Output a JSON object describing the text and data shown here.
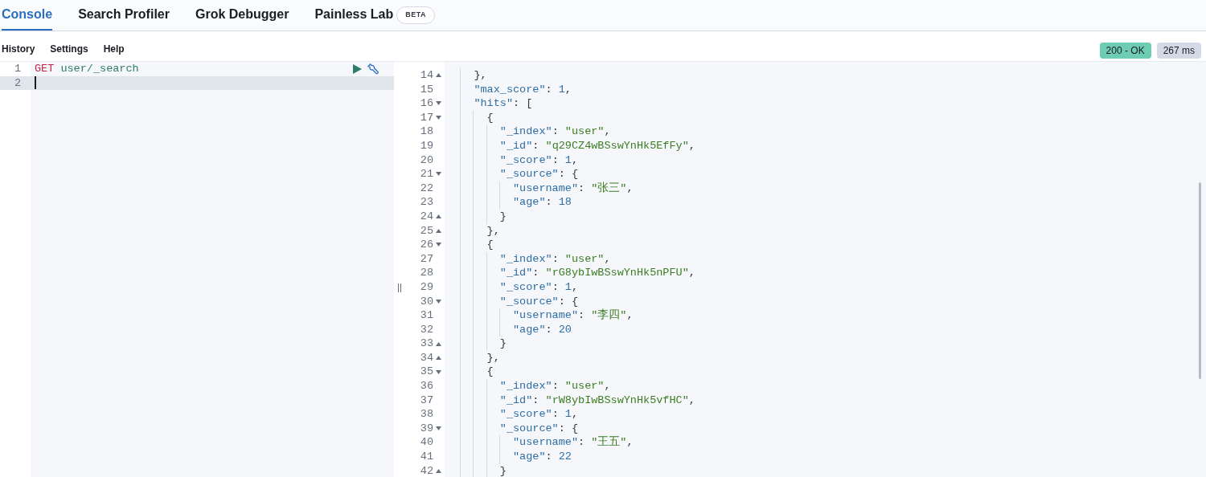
{
  "tabs": [
    {
      "label": "Console",
      "selected": true
    },
    {
      "label": "Search Profiler",
      "selected": false
    },
    {
      "label": "Grok Debugger",
      "selected": false
    },
    {
      "label": "Painless Lab",
      "selected": false,
      "badge": "BETA"
    }
  ],
  "menu": [
    "History",
    "Settings",
    "Help"
  ],
  "status": {
    "code": "200 - OK",
    "time": "267 ms"
  },
  "request": {
    "lines": [
      {
        "number": "1",
        "active": false,
        "tokens": [
          {
            "kind": "method",
            "text": "GET"
          },
          {
            "kind": "path",
            "text": " user/_search"
          }
        ]
      },
      {
        "number": "2",
        "active": true
      }
    ]
  },
  "response": {
    "lines": [
      {
        "number": "14",
        "kind": "close",
        "tokens": [
          {
            "kind": "punct",
            "text": "    },"
          }
        ]
      },
      {
        "number": "15",
        "kind": "plain",
        "tokens": [
          {
            "kind": "key",
            "text": "    \"max_score\""
          },
          {
            "kind": "punct",
            "text": ": "
          },
          {
            "kind": "number",
            "text": "1"
          },
          {
            "kind": "punct",
            "text": ","
          }
        ]
      },
      {
        "number": "16",
        "kind": "open",
        "tokens": [
          {
            "kind": "key",
            "text": "    \"hits\""
          },
          {
            "kind": "punct",
            "text": ": ["
          }
        ]
      },
      {
        "number": "17",
        "kind": "open",
        "tokens": [
          {
            "kind": "punct",
            "text": "      {"
          }
        ]
      },
      {
        "number": "18",
        "kind": "plain",
        "tokens": [
          {
            "kind": "key",
            "text": "        \"_index\""
          },
          {
            "kind": "punct",
            "text": ": "
          },
          {
            "kind": "string",
            "text": "\"user\""
          },
          {
            "kind": "punct",
            "text": ","
          }
        ]
      },
      {
        "number": "19",
        "kind": "plain",
        "tokens": [
          {
            "kind": "key",
            "text": "        \"_id\""
          },
          {
            "kind": "punct",
            "text": ": "
          },
          {
            "kind": "string",
            "text": "\"q29CZ4wBSswYnHk5EfFy\""
          },
          {
            "kind": "punct",
            "text": ","
          }
        ]
      },
      {
        "number": "20",
        "kind": "plain",
        "tokens": [
          {
            "kind": "key",
            "text": "        \"_score\""
          },
          {
            "kind": "punct",
            "text": ": "
          },
          {
            "kind": "number",
            "text": "1"
          },
          {
            "kind": "punct",
            "text": ","
          }
        ]
      },
      {
        "number": "21",
        "kind": "open",
        "tokens": [
          {
            "kind": "key",
            "text": "        \"_source\""
          },
          {
            "kind": "punct",
            "text": ": {"
          }
        ]
      },
      {
        "number": "22",
        "kind": "plain",
        "tokens": [
          {
            "kind": "key",
            "text": "          \"username\""
          },
          {
            "kind": "punct",
            "text": ": "
          },
          {
            "kind": "string",
            "text": "\"张三\""
          },
          {
            "kind": "punct",
            "text": ","
          }
        ]
      },
      {
        "number": "23",
        "kind": "plain",
        "tokens": [
          {
            "kind": "key",
            "text": "          \"age\""
          },
          {
            "kind": "punct",
            "text": ": "
          },
          {
            "kind": "number",
            "text": "18"
          }
        ]
      },
      {
        "number": "24",
        "kind": "close",
        "tokens": [
          {
            "kind": "punct",
            "text": "        }"
          }
        ]
      },
      {
        "number": "25",
        "kind": "close",
        "tokens": [
          {
            "kind": "punct",
            "text": "      },"
          }
        ]
      },
      {
        "number": "26",
        "kind": "open",
        "tokens": [
          {
            "kind": "punct",
            "text": "      {"
          }
        ]
      },
      {
        "number": "27",
        "kind": "plain",
        "tokens": [
          {
            "kind": "key",
            "text": "        \"_index\""
          },
          {
            "kind": "punct",
            "text": ": "
          },
          {
            "kind": "string",
            "text": "\"user\""
          },
          {
            "kind": "punct",
            "text": ","
          }
        ]
      },
      {
        "number": "28",
        "kind": "plain",
        "tokens": [
          {
            "kind": "key",
            "text": "        \"_id\""
          },
          {
            "kind": "punct",
            "text": ": "
          },
          {
            "kind": "string",
            "text": "\"rG8ybIwBSswYnHk5nPFU\""
          },
          {
            "kind": "punct",
            "text": ","
          }
        ]
      },
      {
        "number": "29",
        "kind": "plain",
        "tokens": [
          {
            "kind": "key",
            "text": "        \"_score\""
          },
          {
            "kind": "punct",
            "text": ": "
          },
          {
            "kind": "number",
            "text": "1"
          },
          {
            "kind": "punct",
            "text": ","
          }
        ]
      },
      {
        "number": "30",
        "kind": "open",
        "tokens": [
          {
            "kind": "key",
            "text": "        \"_source\""
          },
          {
            "kind": "punct",
            "text": ": {"
          }
        ]
      },
      {
        "number": "31",
        "kind": "plain",
        "tokens": [
          {
            "kind": "key",
            "text": "          \"username\""
          },
          {
            "kind": "punct",
            "text": ": "
          },
          {
            "kind": "string",
            "text": "\"李四\""
          },
          {
            "kind": "punct",
            "text": ","
          }
        ]
      },
      {
        "number": "32",
        "kind": "plain",
        "tokens": [
          {
            "kind": "key",
            "text": "          \"age\""
          },
          {
            "kind": "punct",
            "text": ": "
          },
          {
            "kind": "number",
            "text": "20"
          }
        ]
      },
      {
        "number": "33",
        "kind": "close",
        "tokens": [
          {
            "kind": "punct",
            "text": "        }"
          }
        ]
      },
      {
        "number": "34",
        "kind": "close",
        "tokens": [
          {
            "kind": "punct",
            "text": "      },"
          }
        ]
      },
      {
        "number": "35",
        "kind": "open",
        "tokens": [
          {
            "kind": "punct",
            "text": "      {"
          }
        ]
      },
      {
        "number": "36",
        "kind": "plain",
        "tokens": [
          {
            "kind": "key",
            "text": "        \"_index\""
          },
          {
            "kind": "punct",
            "text": ": "
          },
          {
            "kind": "string",
            "text": "\"user\""
          },
          {
            "kind": "punct",
            "text": ","
          }
        ]
      },
      {
        "number": "37",
        "kind": "plain",
        "tokens": [
          {
            "kind": "key",
            "text": "        \"_id\""
          },
          {
            "kind": "punct",
            "text": ": "
          },
          {
            "kind": "string",
            "text": "\"rW8ybIwBSswYnHk5vfHC\""
          },
          {
            "kind": "punct",
            "text": ","
          }
        ]
      },
      {
        "number": "38",
        "kind": "plain",
        "tokens": [
          {
            "kind": "key",
            "text": "        \"_score\""
          },
          {
            "kind": "punct",
            "text": ": "
          },
          {
            "kind": "number",
            "text": "1"
          },
          {
            "kind": "punct",
            "text": ","
          }
        ]
      },
      {
        "number": "39",
        "kind": "open",
        "tokens": [
          {
            "kind": "key",
            "text": "        \"_source\""
          },
          {
            "kind": "punct",
            "text": ": {"
          }
        ]
      },
      {
        "number": "40",
        "kind": "plain",
        "tokens": [
          {
            "kind": "key",
            "text": "          \"username\""
          },
          {
            "kind": "punct",
            "text": ": "
          },
          {
            "kind": "string",
            "text": "\"王五\""
          },
          {
            "kind": "punct",
            "text": ","
          }
        ]
      },
      {
        "number": "41",
        "kind": "plain",
        "tokens": [
          {
            "kind": "key",
            "text": "          \"age\""
          },
          {
            "kind": "punct",
            "text": ": "
          },
          {
            "kind": "number",
            "text": "22"
          }
        ]
      },
      {
        "number": "42",
        "kind": "close",
        "tokens": [
          {
            "kind": "punct",
            "text": "        }"
          }
        ]
      }
    ]
  }
}
